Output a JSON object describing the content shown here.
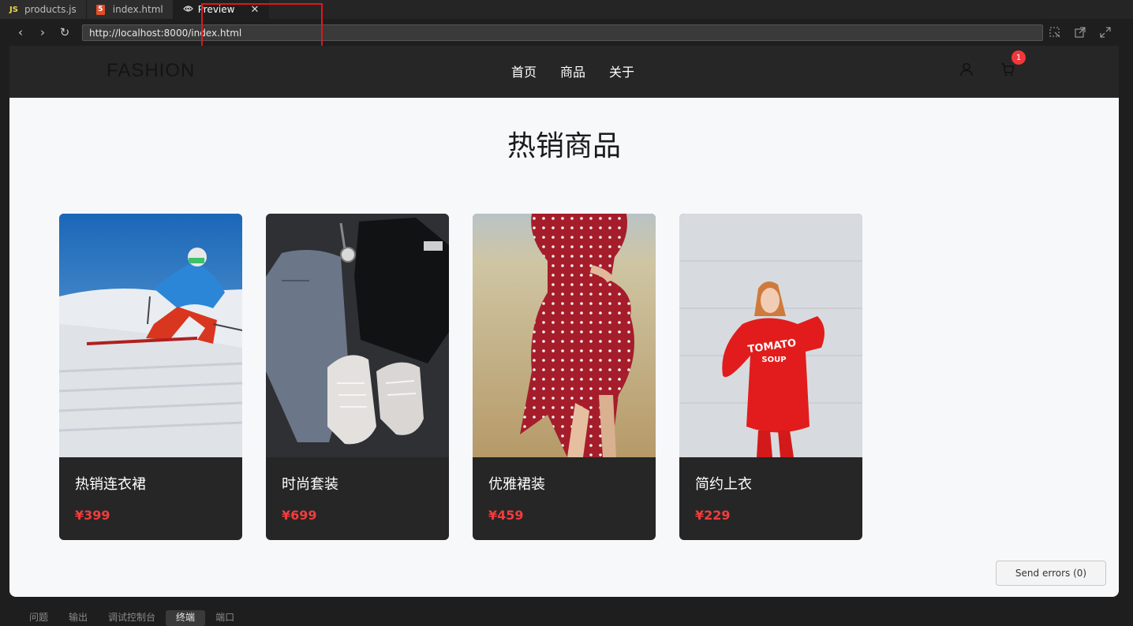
{
  "editor": {
    "tabs": [
      {
        "icon": "js-file-icon",
        "label": "products.js",
        "badge": "JS"
      },
      {
        "icon": "html-file-icon",
        "label": "index.html",
        "badge": "5"
      },
      {
        "icon": "eye-icon",
        "label": "Preview",
        "active": true
      }
    ]
  },
  "browser": {
    "url": "http://localhost:8000/index.html"
  },
  "site": {
    "logo": "FASHION",
    "nav": [
      "首页",
      "商品",
      "关于"
    ],
    "cart_count": "1",
    "section_title": "热销商品",
    "products": [
      {
        "name": "热销连衣裙",
        "price": "¥399",
        "image": "skier-photo"
      },
      {
        "name": "时尚套装",
        "price": "¥699",
        "image": "flatlay-outfit-photo"
      },
      {
        "name": "优雅裙装",
        "price": "¥459",
        "image": "polka-dot-dress-photo"
      },
      {
        "name": "简约上衣",
        "price": "¥229",
        "image": "red-sweatshirt-photo"
      }
    ],
    "sweatshirt_text": [
      "TOMATO",
      "SOUP"
    ],
    "send_errors": "Send errors (0)"
  },
  "panel": {
    "tabs": [
      "问题",
      "输出",
      "调试控制台",
      "终端",
      "端口"
    ],
    "active": "终端"
  },
  "colors": {
    "accent_price": "#f23c3c",
    "header_bg": "#262626",
    "badge": "#f0383b",
    "highlight_box": "#e0161c"
  }
}
